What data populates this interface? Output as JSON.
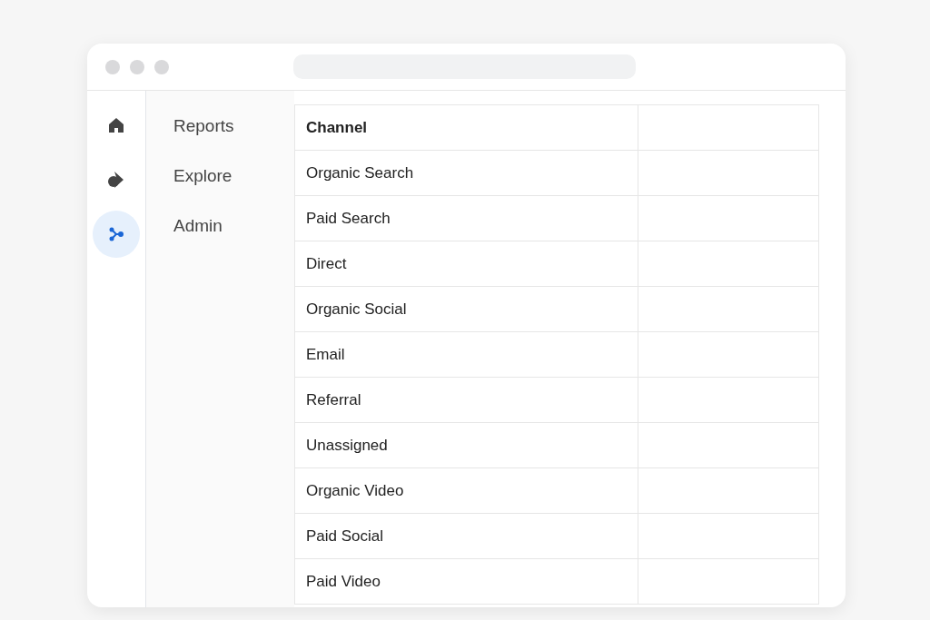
{
  "rail": [
    {
      "kind": "home",
      "selected": false
    },
    {
      "kind": "explore",
      "selected": false
    },
    {
      "kind": "admin",
      "selected": true
    }
  ],
  "nav": [
    "Reports",
    "Explore",
    "Admin"
  ],
  "table": {
    "columns": [
      "Channel"
    ],
    "rows": [
      "Organic Search",
      "Paid Search",
      "Direct",
      "Organic Social",
      "Email",
      "Referral",
      "Unassigned",
      "Organic Video",
      "Paid Social",
      "Paid Video"
    ]
  }
}
